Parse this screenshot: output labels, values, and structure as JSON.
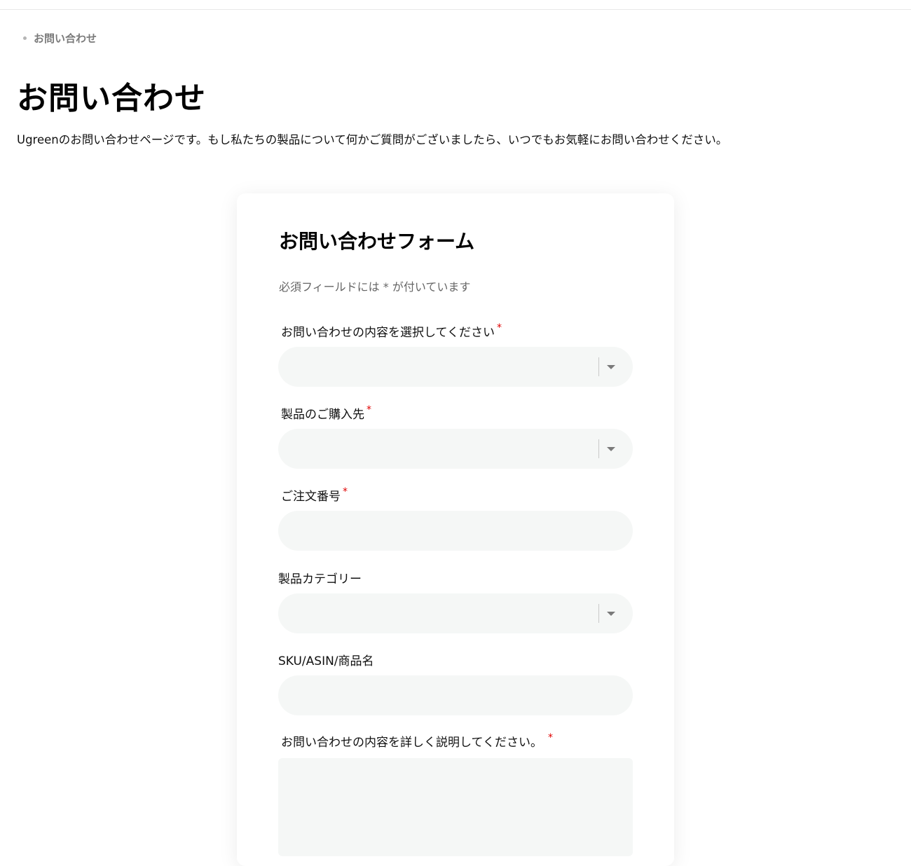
{
  "breadcrumb": {
    "current": "お問い合わせ"
  },
  "page": {
    "title": "お問い合わせ",
    "description": "Ugreenのお問い合わせページです。もし私たちの製品について何かご質問がございましたら、いつでもお気軽にお問い合わせください。"
  },
  "form": {
    "title": "お問い合わせフォーム",
    "required_note": "必須フィールドには * が付いています",
    "required_mark": "*",
    "fields": {
      "inquiry_type": {
        "label": "お問い合わせの内容を選択してください",
        "value": ""
      },
      "purchase_place": {
        "label": "製品のご購入先",
        "value": ""
      },
      "order_number": {
        "label": "ご注文番号",
        "value": ""
      },
      "product_category": {
        "label": "製品カテゴリー",
        "value": ""
      },
      "sku": {
        "label": "SKU/ASIN/商品名",
        "value": ""
      },
      "details": {
        "label": "お問い合わせの内容を詳しく説明してください。",
        "value": ""
      }
    }
  }
}
